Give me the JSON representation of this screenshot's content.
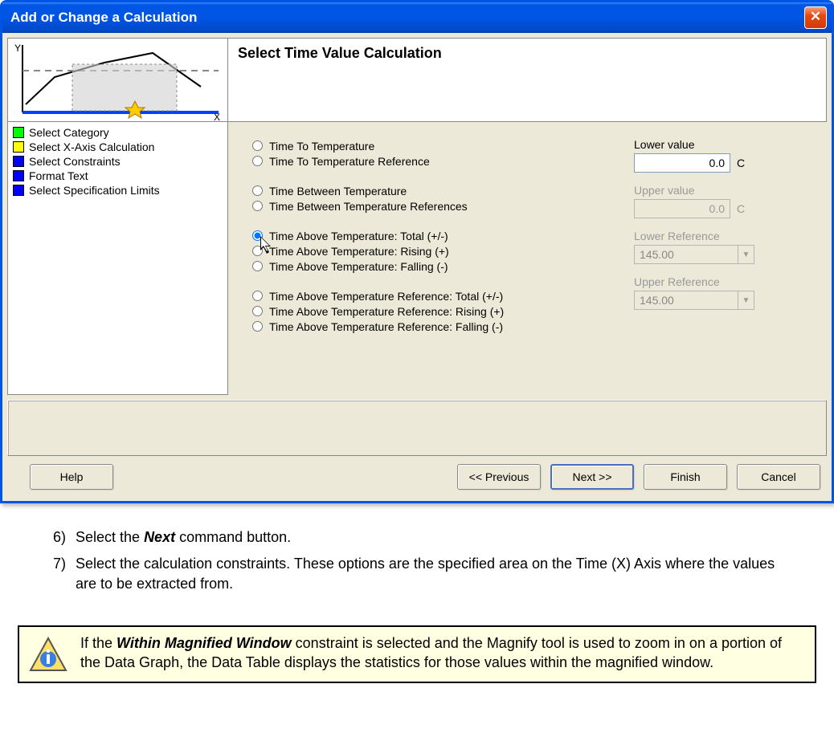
{
  "window": {
    "title": "Add or Change a Calculation",
    "close_label": "✕"
  },
  "header": {
    "title": "Select Time Value Calculation"
  },
  "nav": {
    "items": [
      {
        "color": "#00ff00",
        "label": "Select Category"
      },
      {
        "color": "#ffff00",
        "label": "Select X-Axis Calculation"
      },
      {
        "color": "#0000ff",
        "label": "Select Constraints"
      },
      {
        "color": "#0000ff",
        "label": "Format Text"
      },
      {
        "color": "#0000ff",
        "label": "Select Specification Limits"
      }
    ]
  },
  "radios": {
    "group1": [
      "Time To Temperature",
      "Time To Temperature Reference"
    ],
    "group2": [
      "Time Between Temperature",
      "Time Between Temperature References"
    ],
    "group3": [
      "Time Above Temperature: Total (+/-)",
      "Time Above Temperature: Rising (+)",
      "Time Above Temperature: Falling (-)"
    ],
    "group4": [
      "Time Above Temperature Reference: Total (+/-)",
      "Time Above Temperature Reference: Rising (+)",
      "Time Above Temperature Reference: Falling (-)"
    ],
    "selected": "Time Above Temperature: Total (+/-)"
  },
  "fields": {
    "lower_value": {
      "label": "Lower value",
      "value": "0.0",
      "unit": "C",
      "enabled": true
    },
    "upper_value": {
      "label": "Upper value",
      "value": "0.0",
      "unit": "C",
      "enabled": false
    },
    "lower_ref": {
      "label": "Lower Reference",
      "value": "145.00",
      "enabled": false
    },
    "upper_ref": {
      "label": "Upper Reference",
      "value": "145.00",
      "enabled": false
    }
  },
  "buttons": {
    "help": "Help",
    "prev": "<< Previous",
    "next": "Next >>",
    "finish": "Finish",
    "cancel": "Cancel"
  },
  "doc": {
    "step6_num": "6)",
    "step6_pre": "Select the ",
    "step6_bold": "Next",
    "step6_post": " command button.",
    "step7_num": "7)",
    "step7": "Select the calculation constraints. These options are the specified area on the Time (X) Axis where the values are to be extracted from.",
    "note_pre": "If the ",
    "note_bold": "Within Magnified Window",
    "note_post": " constraint is selected and the Magnify tool is used to zoom in on a portion of the Data Graph, the Data Table displays the statistics for those values within the magnified window."
  }
}
